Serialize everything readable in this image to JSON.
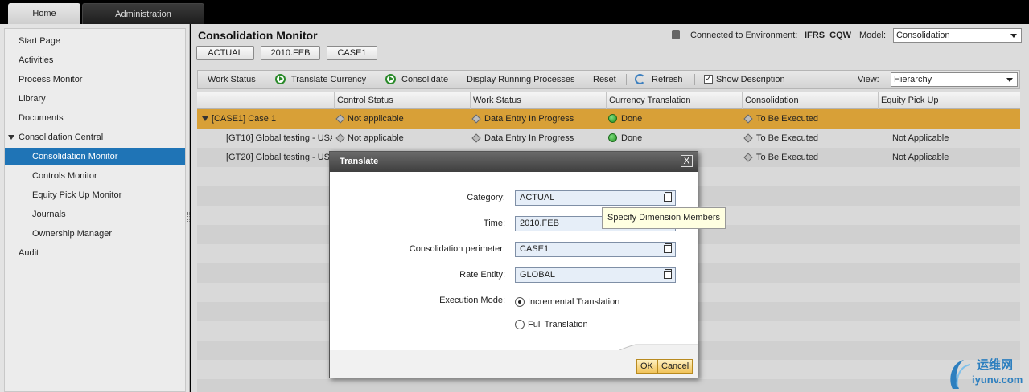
{
  "top_tabs": {
    "home": "Home",
    "administration": "Administration"
  },
  "sidebar": {
    "items": [
      {
        "label": "Start Page"
      },
      {
        "label": "Activities"
      },
      {
        "label": "Process Monitor"
      },
      {
        "label": "Library"
      },
      {
        "label": "Documents"
      },
      {
        "label": "Consolidation Central"
      },
      {
        "label": "Consolidation Monitor"
      },
      {
        "label": "Controls Monitor"
      },
      {
        "label": "Equity Pick Up Monitor"
      },
      {
        "label": "Journals"
      },
      {
        "label": "Ownership Manager"
      },
      {
        "label": "Audit"
      }
    ]
  },
  "header": {
    "title": "Consolidation Monitor",
    "context": [
      "ACTUAL",
      "2010.FEB",
      "CASE1"
    ],
    "env_label": "Connected to Environment:",
    "env_value": "IFRS_CQW",
    "model_label": "Model:",
    "model_value": "Consolidation"
  },
  "toolbar": {
    "work_status": "Work Status",
    "translate_currency": "Translate Currency",
    "consolidate": "Consolidate",
    "display_running": "Display Running Processes",
    "reset": "Reset",
    "refresh": "Refresh",
    "show_description": "Show Description",
    "view_label": "View:",
    "view_value": "Hierarchy"
  },
  "grid": {
    "columns": [
      "Control Status",
      "Work Status",
      "Currency Translation",
      "Consolidation",
      "Equity Pick Up"
    ],
    "rows": [
      {
        "name": "[CASE1] Case 1",
        "control": "Not applicable",
        "work": "Data Entry In Progress",
        "currency": "Done",
        "consolidation": "To Be Executed",
        "equity": ""
      },
      {
        "name": "[GT10] Global testing - USA",
        "control": "Not applicable",
        "work": "Data Entry In Progress",
        "currency": "Done",
        "consolidation": "To Be Executed",
        "equity": "Not Applicable"
      },
      {
        "name": "[GT20] Global testing - USA",
        "control": "",
        "work": "",
        "currency": "",
        "consolidation": "To Be Executed",
        "equity": "Not Applicable"
      }
    ]
  },
  "dialog": {
    "title": "Translate",
    "close": "X",
    "category_label": "Category:",
    "category_value": "ACTUAL",
    "time_label": "Time:",
    "time_value": "2010.FEB",
    "perimeter_label": "Consolidation perimeter:",
    "perimeter_value": "CASE1",
    "rate_label": "Rate Entity:",
    "rate_value": "GLOBAL",
    "mode_label": "Execution Mode:",
    "mode_incremental": "Incremental Translation",
    "mode_full": "Full Translation",
    "ok": "OK",
    "cancel": "Cancel"
  },
  "tooltip": "Specify Dimension Members",
  "watermark": {
    "line1": "运维网",
    "line2": "iyunv.com"
  }
}
